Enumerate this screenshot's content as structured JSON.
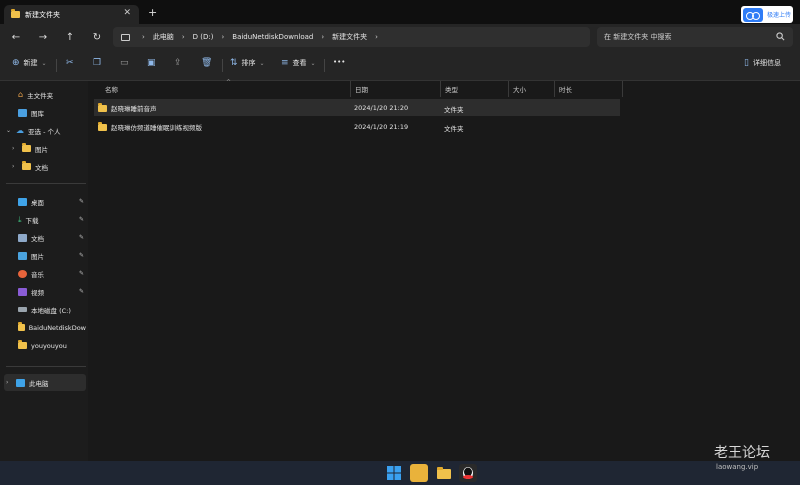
{
  "tab": {
    "title": "新建文件夹",
    "close": "✕",
    "new": "+"
  },
  "baidu": {
    "label": "极速上传"
  },
  "nav": {
    "back": "←",
    "forward": "→",
    "up": "↑",
    "refresh": "↻",
    "more": "›",
    "crumbs": [
      "此电脑",
      "D (D:)",
      "BaiduNetdiskDownload",
      "新建文件夹"
    ],
    "search_placeholder": "在 新建文件夹 中搜索"
  },
  "toolbar": {
    "new": "新建",
    "sort": "排序",
    "view": "查看",
    "more": "•••",
    "details": "详细信息"
  },
  "sidebar": {
    "home": "主文件夹",
    "gallery": "图库",
    "cloud": "亚选 - 个人",
    "cloud_children": [
      "图片",
      "文档"
    ],
    "quick": [
      {
        "label": "桌面",
        "pinned": true
      },
      {
        "label": "下载",
        "pinned": true
      },
      {
        "label": "文档",
        "pinned": true
      },
      {
        "label": "图片",
        "pinned": true
      },
      {
        "label": "音乐",
        "pinned": true
      },
      {
        "label": "视频",
        "pinned": true
      },
      {
        "label": "本地磁盘 (C:)",
        "pinned": false
      },
      {
        "label": "BaiduNetdiskDow",
        "pinned": false
      },
      {
        "label": "youyouyou",
        "pinned": false
      }
    ],
    "thispc": "此电脑",
    "pin_icon": "📌"
  },
  "columns": {
    "name": "名称",
    "date": "日期",
    "type": "类型",
    "size": "大小",
    "duration": "时长"
  },
  "files": [
    {
      "name": "赵晓琳睡前音声",
      "date": "2024/1/20 21:20",
      "type": "文件夹"
    },
    {
      "name": "赵晓琳仿频道睡催眠训练视频版",
      "date": "2024/1/20 21:19",
      "type": "文件夹"
    }
  ],
  "watermark": {
    "title": "老王论坛",
    "sub": "laowang.vip"
  },
  "colors": {
    "accent": "#2e7cf6",
    "folder": "#f0c14b"
  }
}
